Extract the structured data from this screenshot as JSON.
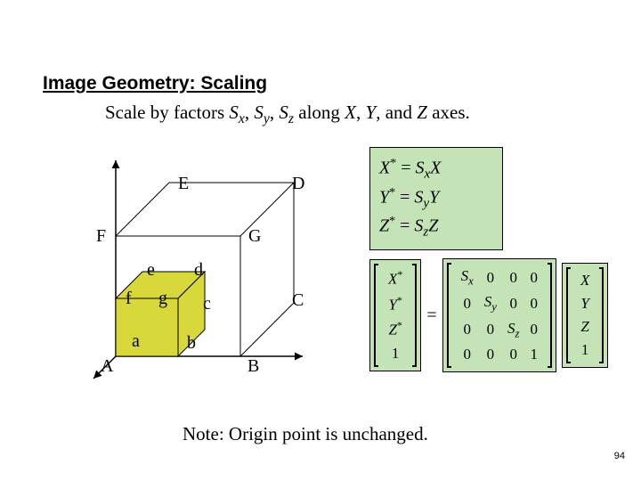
{
  "title": "Image Geometry: Scaling",
  "subtitle": {
    "pre": "Scale by factors ",
    "s1": "S",
    "s1sub": "x",
    "sep1": ", ",
    "s2": "S",
    "s2sub": "y",
    "sep2": ", ",
    "s3": "S",
    "s3sub": "z",
    "mid": " along ",
    "x": "X",
    "c1": ", ",
    "y": "Y",
    "c2": ", and ",
    "z": "Z",
    "post": " axes."
  },
  "labels": {
    "E": "E",
    "D": "D",
    "F": "F",
    "G": "G",
    "e": "e",
    "d": "d",
    "f": "f",
    "g": "g",
    "a": "a",
    "b": "b",
    "c": "c",
    "A": "A",
    "B": "B",
    "C": "C"
  },
  "eq": {
    "r1a": "X",
    "r1sup": "*",
    "r1eq": " = ",
    "r1b": "S",
    "r1sub": "x",
    "r1c": "X",
    "r2a": "Y",
    "r2sup": "*",
    "r2eq": " = ",
    "r2b": "S",
    "r2sub": "y",
    "r2c": "Y",
    "r3a": "Z",
    "r3sup": "*",
    "r3eq": " = ",
    "r3b": "S",
    "r3sub": "z",
    "r3c": "Z"
  },
  "mat": {
    "lhs": {
      "r1": "X",
      "r1s": "*",
      "r2": "Y",
      "r2s": "*",
      "r3": "Z",
      "r3s": "*",
      "r4": "1"
    },
    "eq": "=",
    "mid": {
      "r1c1a": "S",
      "r1c1b": "x",
      "r1c2": "0",
      "r1c3": "0",
      "r1c4": "0",
      "r2c1": "0",
      "r2c2a": "S",
      "r2c2b": "y",
      "r2c3": "0",
      "r2c4": "0",
      "r3c1": "0",
      "r3c2": "0",
      "r3c3a": "S",
      "r3c3b": "z",
      "r3c4": "0",
      "r4c1": "0",
      "r4c2": "0",
      "r4c3": "0",
      "r4c4": "1"
    },
    "rhs": {
      "r1": "X",
      "r2": "Y",
      "r3": "Z",
      "r4": "1"
    }
  },
  "note": "Note: Origin point is unchanged.",
  "pagenum": "94",
  "colors": {
    "fill_small": "#d8d83a",
    "fill_faces": "#c4e4b8"
  }
}
